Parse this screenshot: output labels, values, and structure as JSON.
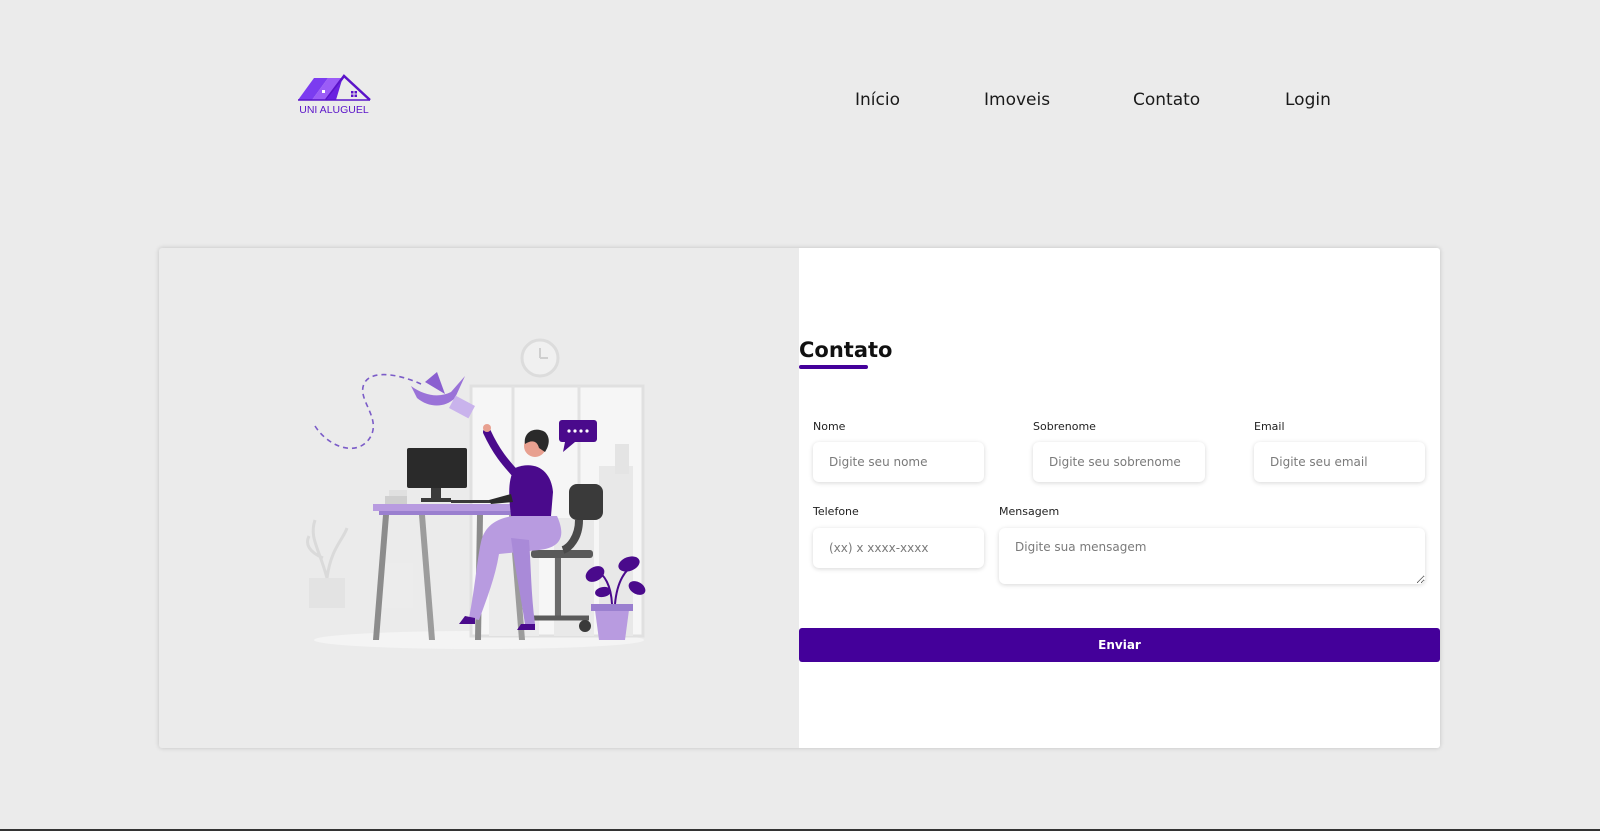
{
  "header": {
    "logo_text": "UNI ALUGUEL",
    "nav": [
      "Início",
      "Imoveis",
      "Contato",
      "Login"
    ]
  },
  "form": {
    "title": "Contato",
    "fields": {
      "nome": {
        "label": "Nome",
        "placeholder": "Digite seu nome"
      },
      "sobrenome": {
        "label": "Sobrenome",
        "placeholder": "Digite seu sobrenome"
      },
      "email": {
        "label": "Email",
        "placeholder": "Digite seu email"
      },
      "telefone": {
        "label": "Telefone",
        "placeholder": "(xx) x xxxx-xxxx"
      },
      "mensagem": {
        "label": "Mensagem",
        "placeholder": "Digite sua mensagem"
      }
    },
    "submit_label": "Enviar"
  },
  "colors": {
    "brand": "#44009a",
    "logo": "#7b3cf0",
    "page_bg": "#ebebeb",
    "illustration_purple": "#4a0a8c",
    "illustration_lavender": "#b89be0"
  },
  "illustration": {
    "icon": "woman-at-desk-sending-mail-illustration"
  }
}
